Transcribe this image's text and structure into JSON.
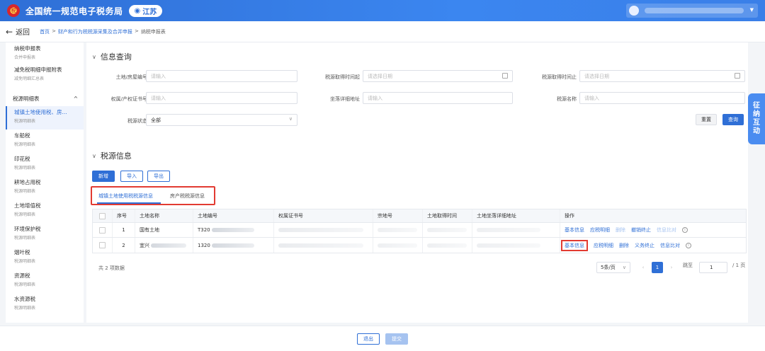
{
  "header": {
    "emblem_text": "税",
    "title": "全国统一规范电子税务局",
    "region": "江苏",
    "region_icon": "location-pin-icon"
  },
  "nav": {
    "back": "返回",
    "breadcrumb": [
      "首页",
      "财产和行为税税源采集及合并申报",
      "纳税申报表"
    ],
    "separator": ">"
  },
  "sidebar": {
    "items": [
      {
        "title": "纳税申报表",
        "sub": "合并申报表"
      },
      {
        "title": "减免税明细申报附表",
        "sub": "减免明细汇总表"
      }
    ],
    "group": {
      "title": "税源明细表",
      "chevron": "^"
    },
    "source_items": [
      {
        "title": "城镇土地使用税、房...",
        "sub": "税源明细表"
      },
      {
        "title": "车船税",
        "sub": "税源明细表"
      },
      {
        "title": "印花税",
        "sub": "税源明细表"
      },
      {
        "title": "耕地占用税",
        "sub": "税源明细表"
      },
      {
        "title": "土地增值税",
        "sub": "税源明细表"
      },
      {
        "title": "环境保护税",
        "sub": "税源明细表"
      },
      {
        "title": "烟叶税",
        "sub": "税源明细表"
      },
      {
        "title": "资源税",
        "sub": "税源明细表"
      },
      {
        "title": "水资源税",
        "sub": "税源明细表"
      }
    ]
  },
  "query": {
    "title": "信息查询",
    "labels": {
      "land_code": "土地/房屋编号",
      "acquire_start": "税源取得时间起",
      "acquire_end": "税源取得时间止",
      "cert_no": "权属/产权证书号",
      "address": "坐落详细地址",
      "source_name": "税源名称",
      "status": "税源状态"
    },
    "placeholders": {
      "input": "请输入",
      "date": "请选择日期"
    },
    "status_value": "全部",
    "reset": "重置",
    "search": "查询"
  },
  "source": {
    "title": "税源信息",
    "buttons": {
      "add": "新增",
      "import": "导入",
      "export": "导出"
    },
    "tabs": [
      "城镇土地使用税税源信息",
      "房产税税源信息"
    ]
  },
  "table": {
    "columns": [
      "序号",
      "土地名称",
      "土地编号",
      "权属证书号",
      "宗地号",
      "土地取得时间",
      "土地坐落详细地址",
      "操作"
    ],
    "rows": [
      {
        "no": "1",
        "name": "国有土地",
        "code": "T320",
        "ops": [
          "基本信息",
          "应税明细",
          "删除",
          "撤销终止",
          "信息比对"
        ]
      },
      {
        "no": "2",
        "name": "宜兴",
        "code": "1320",
        "ops": [
          "基本信息",
          "应税明细",
          "删除",
          "义务终止",
          "信息比对"
        ]
      }
    ]
  },
  "pagination": {
    "total": "共 2 项数据",
    "page_size": "5条/页",
    "current": "1",
    "jump_label": "跳至",
    "jump_value": "1",
    "pages": "/ 1 页"
  },
  "float_tab": [
    "征",
    "纳",
    "互",
    "动"
  ],
  "footer": {
    "exit": "退出",
    "submit": "提交"
  },
  "colors": {
    "primary": "#2f6fd6",
    "highlight": "#e23b32"
  }
}
